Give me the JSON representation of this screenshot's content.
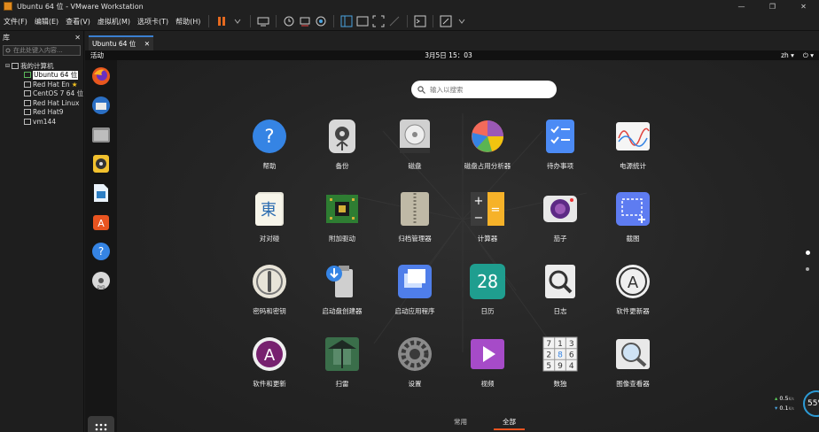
{
  "window": {
    "title": "Ubuntu 64 位 - VMware Workstation",
    "controls": [
      "—",
      "❐",
      "✕"
    ]
  },
  "menu": [
    "文件(F)",
    "编辑(E)",
    "查看(V)",
    "虚拟机(M)",
    "选项卡(T)",
    "帮助(H)"
  ],
  "library": {
    "title": "库",
    "search_placeholder": "在此处键入内容...",
    "root": "我的计算机",
    "vms": [
      "Ubuntu 64 位",
      "Red Hat En",
      "CentOS 7 64 位",
      "Red Hat Linux",
      "Red Hat9",
      "vm144"
    ]
  },
  "tab": {
    "label": "Ubuntu 64 位"
  },
  "gnome": {
    "activities": "活动",
    "clock": "3月5日 15：03",
    "lang": "zh ▾",
    "power": "⏻ ▾"
  },
  "search": {
    "placeholder": "输入以搜索"
  },
  "apps": [
    {
      "label": "帮助",
      "icon": "help-icon"
    },
    {
      "label": "备份",
      "icon": "backup-icon"
    },
    {
      "label": "磁盘",
      "icon": "disks-icon"
    },
    {
      "label": "磁盘占用分析器",
      "icon": "disk-usage-icon"
    },
    {
      "label": "待办事项",
      "icon": "todo-icon"
    },
    {
      "label": "电源统计",
      "icon": "power-stats-icon"
    },
    {
      "label": "对对碰",
      "icon": "mahjongg-icon"
    },
    {
      "label": "附加驱动",
      "icon": "drivers-icon"
    },
    {
      "label": "归档管理器",
      "icon": "archive-icon"
    },
    {
      "label": "计算器",
      "icon": "calculator-icon"
    },
    {
      "label": "茄子",
      "icon": "cheese-icon"
    },
    {
      "label": "截图",
      "icon": "screenshot-icon"
    },
    {
      "label": "密码和密钥",
      "icon": "passwords-icon"
    },
    {
      "label": "启动盘创建器",
      "icon": "usb-creator-icon"
    },
    {
      "label": "启动应用程序",
      "icon": "startup-apps-icon"
    },
    {
      "label": "日历",
      "icon": "calendar-icon",
      "text": "28"
    },
    {
      "label": "日志",
      "icon": "logs-icon"
    },
    {
      "label": "软件更新器",
      "icon": "software-updater-icon"
    },
    {
      "label": "软件和更新",
      "icon": "software-updates-icon"
    },
    {
      "label": "扫雷",
      "icon": "mines-icon"
    },
    {
      "label": "设置",
      "icon": "settings-icon"
    },
    {
      "label": "视频",
      "icon": "videos-icon"
    },
    {
      "label": "数独",
      "icon": "sudoku-icon",
      "text": [
        "7",
        "1",
        "3",
        "2",
        "6",
        "",
        "5",
        "9",
        "4",
        "8"
      ]
    },
    {
      "label": "图像查看器",
      "icon": "image-viewer-icon"
    }
  ],
  "bottom_tabs": {
    "frequent": "常用",
    "all": "全部"
  },
  "net": {
    "up": "0.5",
    "down": "0.1",
    "unit": "K/s",
    "percent": "55%"
  },
  "colors": {
    "accent": "#e95420",
    "vmware_tab": "#3b7fcf"
  }
}
